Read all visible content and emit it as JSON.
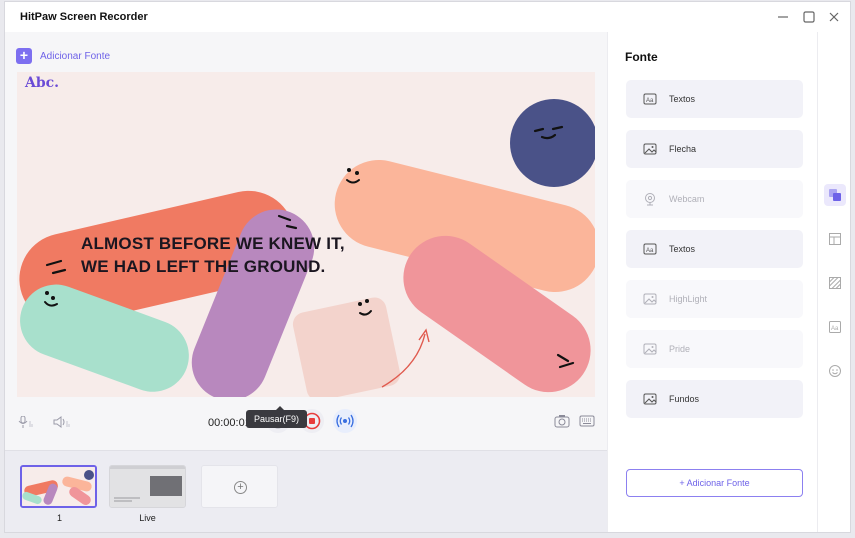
{
  "window": {
    "title": "HitPaw Screen Recorder"
  },
  "toolbar": {
    "add_source_label": "Adicionar Fonte"
  },
  "canvas": {
    "logo": "Abc.",
    "headline_line1": "ALMOST BEFORE WE KNEW IT,",
    "headline_line2": "WE HAD LEFT THE GROUND."
  },
  "controls": {
    "timer": "00:00:01",
    "pause_tooltip": "Pausar(F9)"
  },
  "scenes": [
    {
      "label": "1"
    },
    {
      "label": "Live"
    }
  ],
  "panel": {
    "title": "Fonte",
    "items": [
      {
        "label": "Textos",
        "icon": "text-icon",
        "enabled": true
      },
      {
        "label": "Flecha",
        "icon": "image-icon",
        "enabled": true
      },
      {
        "label": "Webcam",
        "icon": "webcam-icon",
        "enabled": false
      },
      {
        "label": "Textos",
        "icon": "text-icon",
        "enabled": true
      },
      {
        "label": "HighLight",
        "icon": "image-icon",
        "enabled": false
      },
      {
        "label": "Pride",
        "icon": "image-icon",
        "enabled": false
      },
      {
        "label": "Fundos",
        "icon": "image-icon",
        "enabled": true
      }
    ],
    "add_button": "+ Adicionar Fonte"
  },
  "colors": {
    "accent": "#6e62e8",
    "canvas_bg": "#f7ecea",
    "shape_coral": "#f07a62",
    "shape_peach": "#fbb59a",
    "shape_purple": "#b888be",
    "shape_mint": "#a8e0cc",
    "shape_pink": "#f0959a",
    "shape_navy": "#4a5288",
    "shape_blush": "#f3d3cc"
  }
}
